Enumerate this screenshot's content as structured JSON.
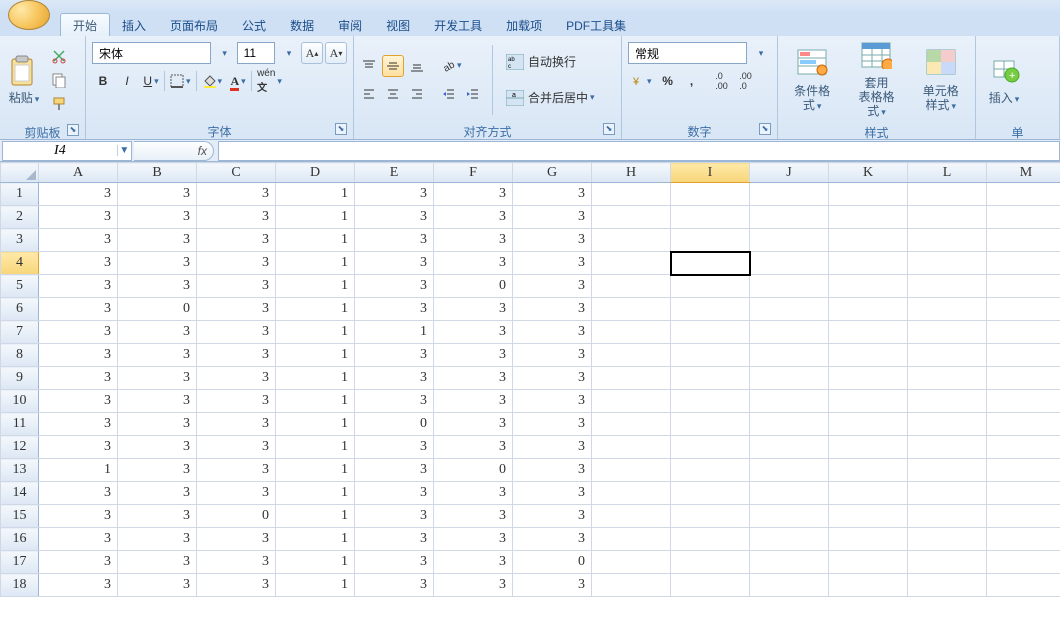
{
  "tabs": [
    "开始",
    "插入",
    "页面布局",
    "公式",
    "数据",
    "审阅",
    "视图",
    "开发工具",
    "加载项",
    "PDF工具集"
  ],
  "active_tab_index": 0,
  "ribbon": {
    "clipboard": {
      "paste": "粘贴",
      "label": "剪贴板"
    },
    "font": {
      "name": "宋体",
      "size": "11",
      "label": "字体"
    },
    "align": {
      "wrap": "自动换行",
      "merge": "合并后居中",
      "label": "对齐方式"
    },
    "number": {
      "format": "常规",
      "label": "数字"
    },
    "styles": {
      "cond": "条件格式",
      "table": "套用\n表格格式",
      "cell": "单元格\n样式",
      "label": "样式"
    },
    "cells": {
      "insert": "插入",
      "label": "单"
    }
  },
  "namebox": "I4",
  "fx_label": "fx",
  "columns": [
    "A",
    "B",
    "C",
    "D",
    "E",
    "F",
    "G",
    "H",
    "I",
    "J",
    "K",
    "L",
    "M"
  ],
  "selected_cell": {
    "row": 4,
    "col": "I"
  },
  "rows": [
    [
      3,
      3,
      3,
      1,
      3,
      3,
      3
    ],
    [
      3,
      3,
      3,
      1,
      3,
      3,
      3
    ],
    [
      3,
      3,
      3,
      1,
      3,
      3,
      3
    ],
    [
      3,
      3,
      3,
      1,
      3,
      3,
      3
    ],
    [
      3,
      3,
      3,
      1,
      3,
      0,
      3
    ],
    [
      3,
      0,
      3,
      1,
      3,
      3,
      3
    ],
    [
      3,
      3,
      3,
      1,
      1,
      3,
      3
    ],
    [
      3,
      3,
      3,
      1,
      3,
      3,
      3
    ],
    [
      3,
      3,
      3,
      1,
      3,
      3,
      3
    ],
    [
      3,
      3,
      3,
      1,
      3,
      3,
      3
    ],
    [
      3,
      3,
      3,
      1,
      0,
      3,
      3
    ],
    [
      3,
      3,
      3,
      1,
      3,
      3,
      3
    ],
    [
      1,
      3,
      3,
      1,
      3,
      0,
      3
    ],
    [
      3,
      3,
      3,
      1,
      3,
      3,
      3
    ],
    [
      3,
      3,
      0,
      1,
      3,
      3,
      3
    ],
    [
      3,
      3,
      3,
      1,
      3,
      3,
      3
    ],
    [
      3,
      3,
      3,
      1,
      3,
      3,
      0
    ],
    [
      3,
      3,
      3,
      1,
      3,
      3,
      3
    ]
  ]
}
